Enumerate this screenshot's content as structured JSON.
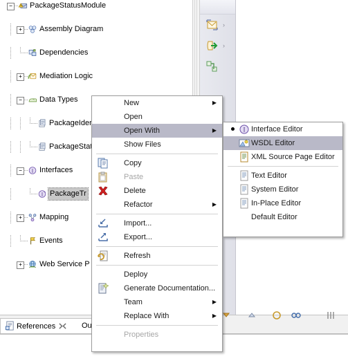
{
  "tree": {
    "items": [
      {
        "label": "PackageStatusModule",
        "depth": 0,
        "expander": "minus",
        "icon": "module-warning-icon"
      },
      {
        "label": "Assembly Diagram",
        "depth": 1,
        "expander": "plus",
        "icon": "assembly-diagram-icon"
      },
      {
        "label": "Dependencies",
        "depth": 1,
        "expander": "none",
        "icon": "dependencies-icon"
      },
      {
        "label": "Mediation Logic",
        "depth": 1,
        "expander": "plus",
        "icon": "mediation-logic-icon"
      },
      {
        "label": "Data Types",
        "depth": 1,
        "expander": "minus",
        "icon": "data-types-icon"
      },
      {
        "label": "PackageIdentifier",
        "depth": 2,
        "expander": "none",
        "icon": "business-object-icon"
      },
      {
        "label": "PackageStatus",
        "depth": 2,
        "expander": "none",
        "icon": "business-object-icon"
      },
      {
        "label": "Interfaces",
        "depth": 1,
        "expander": "minus",
        "icon": "interfaces-folder-icon"
      },
      {
        "label": "PackageTr",
        "depth": 2,
        "expander": "none",
        "icon": "interface-icon",
        "selected": true
      },
      {
        "label": "Mapping",
        "depth": 1,
        "expander": "plus",
        "icon": "mapping-icon"
      },
      {
        "label": "Events",
        "depth": 1,
        "expander": "none",
        "icon": "events-icon"
      },
      {
        "label": "Web Service P",
        "depth": 1,
        "expander": "plus",
        "icon": "web-service-ports-icon"
      }
    ]
  },
  "palette": {
    "items": [
      {
        "name": "mediation-flow-tool",
        "arrow": "›"
      },
      {
        "name": "export-tool",
        "arrow": "›"
      },
      {
        "name": "wire-tool",
        "arrow": ""
      }
    ]
  },
  "context_menu": {
    "items": [
      {
        "label": "New",
        "icon": "",
        "arrow": "▶",
        "state": "normal"
      },
      {
        "label": "Open",
        "icon": "",
        "arrow": "",
        "state": "normal"
      },
      {
        "label": "Open With",
        "icon": "",
        "arrow": "▶",
        "state": "selected"
      },
      {
        "label": "Show Files",
        "icon": "",
        "arrow": "",
        "state": "normal"
      },
      {
        "separator": true
      },
      {
        "label": "Copy",
        "icon": "copy-icon",
        "arrow": "",
        "state": "normal"
      },
      {
        "label": "Paste",
        "icon": "paste-icon",
        "arrow": "",
        "state": "disabled"
      },
      {
        "label": "Delete",
        "icon": "delete-icon",
        "arrow": "",
        "state": "normal"
      },
      {
        "label": "Refactor",
        "icon": "",
        "arrow": "▶",
        "state": "normal"
      },
      {
        "separator": true
      },
      {
        "label": "Import...",
        "icon": "import-icon",
        "arrow": "",
        "state": "normal"
      },
      {
        "label": "Export...",
        "icon": "export-icon",
        "arrow": "",
        "state": "normal"
      },
      {
        "separator": true
      },
      {
        "label": "Refresh",
        "icon": "refresh-icon",
        "arrow": "",
        "state": "normal"
      },
      {
        "separator": true
      },
      {
        "label": "Deploy",
        "icon": "",
        "arrow": "",
        "state": "normal"
      },
      {
        "label": "Generate Documentation...",
        "icon": "generate-doc-icon",
        "arrow": "",
        "state": "normal"
      },
      {
        "label": "Team",
        "icon": "",
        "arrow": "▶",
        "state": "normal"
      },
      {
        "label": "Replace With",
        "icon": "",
        "arrow": "▶",
        "state": "normal"
      },
      {
        "separator": true
      },
      {
        "label": "Properties",
        "icon": "",
        "arrow": "",
        "state": "disabled"
      }
    ]
  },
  "open_with_submenu": {
    "items": [
      {
        "label": "Interface Editor",
        "icon": "interface-icon",
        "state": "normal",
        "bullet": true
      },
      {
        "label": "WSDL Editor",
        "icon": "wsdl-icon",
        "state": "selected",
        "bullet": false
      },
      {
        "label": "XML Source Page Editor",
        "icon": "xml-editor-icon",
        "state": "normal",
        "bullet": false
      },
      {
        "separator": true
      },
      {
        "label": "Text Editor",
        "icon": "text-file-icon",
        "state": "normal",
        "bullet": false
      },
      {
        "label": "System Editor",
        "icon": "text-file-icon",
        "state": "normal",
        "bullet": false
      },
      {
        "label": "In-Place Editor",
        "icon": "text-file-icon",
        "state": "normal",
        "bullet": false
      },
      {
        "label": "Default Editor",
        "icon": "",
        "state": "normal",
        "bullet": false
      }
    ]
  },
  "bottom_tabs": {
    "tabs": [
      {
        "label": "References",
        "active": true,
        "closable": true,
        "icon": "references-icon"
      },
      {
        "label": "Ou",
        "active": false,
        "closable": false,
        "icon": ""
      }
    ]
  },
  "colors": {
    "menu_highlight": "#b9b9c8",
    "tree_selection": "#c8c8c8",
    "menu_bg": "#ffffff",
    "disabled_text": "#a6a6a6"
  }
}
